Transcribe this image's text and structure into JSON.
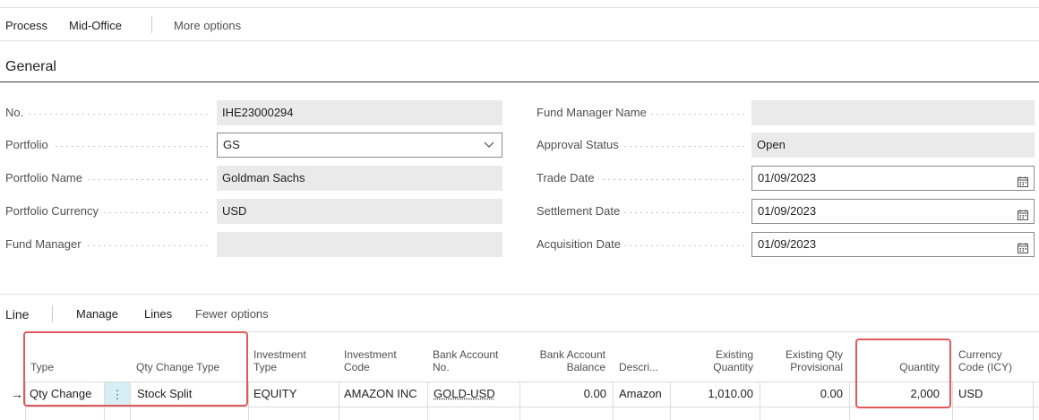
{
  "action_bar": {
    "items": [
      "Process",
      "Mid-Office"
    ],
    "more": "More options"
  },
  "general": {
    "title": "General",
    "left_fields": [
      {
        "label": "No.",
        "value": "IHE23000294"
      },
      {
        "label": "Portfolio",
        "value": "GS"
      },
      {
        "label": "Portfolio Name",
        "value": "Goldman Sachs"
      },
      {
        "label": "Portfolio Currency",
        "value": "USD"
      },
      {
        "label": "Fund Manager",
        "value": ""
      }
    ],
    "right_fields": [
      {
        "label": "Fund Manager Name",
        "value": ""
      },
      {
        "label": "Approval Status",
        "value": "Open"
      },
      {
        "label": "Trade Date",
        "value": "01/09/2023"
      },
      {
        "label": "Settlement Date",
        "value": "01/09/2023"
      },
      {
        "label": "Acquisition Date",
        "value": "01/09/2023"
      }
    ]
  },
  "line": {
    "title": "Line",
    "actions": [
      "Manage",
      "Lines"
    ],
    "fewer": "Fewer options",
    "columns": {
      "type": "Type",
      "qty_change_type": "Qty Change Type",
      "investment_type": [
        "Investment",
        "Type"
      ],
      "investment_code": [
        "Investment",
        "Code"
      ],
      "bank_account_no": [
        "Bank Account",
        "No."
      ],
      "bank_account_balance": [
        "Bank Account",
        "Balance"
      ],
      "description": "Descri...",
      "existing_quantity": [
        "Existing",
        "Quantity"
      ],
      "existing_qty_provisional": [
        "Existing Qty",
        "Provisional"
      ],
      "quantity": "Quantity",
      "currency_code": [
        "Currency",
        "Code (ICY)"
      ]
    },
    "row": {
      "marker": "→",
      "type": "Qty Change",
      "menu": "⋮",
      "qty_change_type": "Stock Split",
      "investment_type": "EQUITY",
      "investment_code": "AMAZON INC",
      "bank_account_no": "GOLD-USD",
      "bank_account_balance": "0.00",
      "description": "Amazon",
      "existing_quantity": "1,010.00",
      "existing_qty_provisional": "0.00",
      "quantity": "2,000",
      "currency_code": "USD"
    }
  },
  "colors": {
    "highlight": "#e2595b",
    "menu_cell": "#d6eef4",
    "readonly_field": "#eaeaea"
  },
  "icons": {
    "calendar": "calendar-icon",
    "chevron": "chevron-down-icon",
    "row_marker": "arrow-right-icon",
    "row_menu": "more-vertical-icon"
  }
}
